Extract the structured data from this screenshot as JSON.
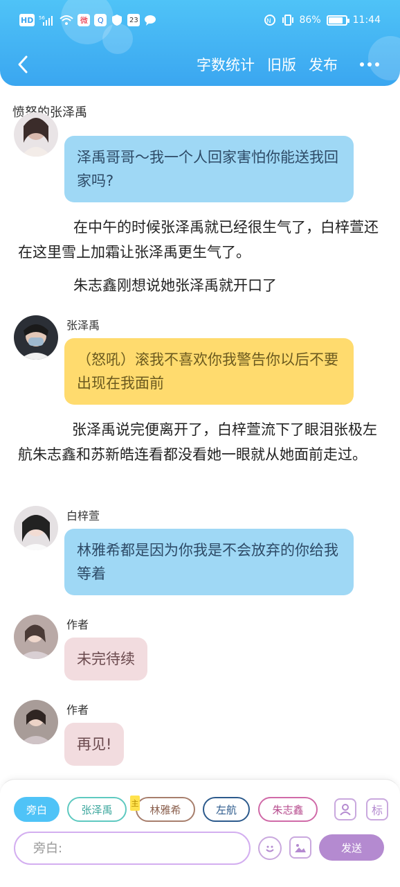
{
  "status_bar": {
    "network": "HD",
    "signal": "5G",
    "battery_percent": "86%",
    "battery_level": 0.86,
    "time": "11:44",
    "calendar_day": "23"
  },
  "header": {
    "actions": [
      "字数统计",
      "旧版",
      "发布"
    ]
  },
  "story_title": "愤怒的张泽禹",
  "messages": [
    {
      "type": "bubble",
      "style": "blue",
      "text": "泽禹哥哥～我一个人回家害怕你能送我回家吗?"
    },
    {
      "type": "narration",
      "text": "在中午的时候张泽禹就已经很生气了，白梓萱还在这里雪上加霜让张泽禹更生气了。"
    },
    {
      "type": "narration",
      "text": "朱志鑫刚想说她张泽禹就开口了"
    },
    {
      "type": "bubble",
      "style": "yellow",
      "name": "张泽禹",
      "text": "（怒吼）滚我不喜欢你我警告你以后不要出现在我面前"
    },
    {
      "type": "narration",
      "text": "张泽禹说完便离开了，白梓萱流下了眼泪张极左航朱志鑫和苏新皓连看都没看她一眼就从她面前走过。"
    },
    {
      "type": "bubble",
      "style": "blue",
      "name": "白梓萱",
      "text": "林雅希都是因为你我是不会放弃的你给我等着"
    },
    {
      "type": "bubble",
      "style": "pink",
      "name": "作者",
      "text": "未完待续"
    },
    {
      "type": "bubble",
      "style": "pink",
      "name": "作者",
      "text": "再见!"
    }
  ],
  "role_chips": [
    "旁白",
    "张泽禹",
    "林雅希",
    "左航",
    "朱志鑫"
  ],
  "chip_badge": "主",
  "icon_buttons": {
    "role_icon": "person-icon",
    "tag_label": "标"
  },
  "input": {
    "placeholder": "旁白:"
  },
  "send_label": "发送"
}
